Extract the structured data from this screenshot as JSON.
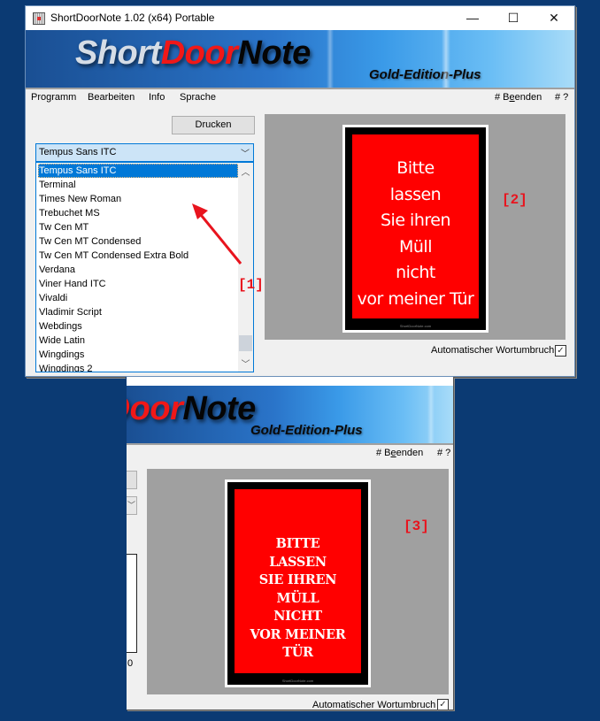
{
  "window": {
    "title": "ShortDoorNote 1.02  (x64) Portable",
    "controls": {
      "minimize": "—",
      "maximize": "☐",
      "close": "✕"
    }
  },
  "banner": {
    "logo_part1": "Short",
    "logo_part2": "Door",
    "logo_part3": "Note",
    "edition": "Gold-Edition-Plus"
  },
  "menu": {
    "items": [
      "Programm",
      "Bearbeiten",
      "Info",
      "Sprache"
    ],
    "right": {
      "quit_prefix": "# B",
      "quit_underlined": "e",
      "quit_suffix": "enden",
      "help": "# ?"
    }
  },
  "toolbar": {
    "print_label": "Drucken"
  },
  "font_select": {
    "selected": "Tempus Sans ITC",
    "options": [
      "Tempus Sans ITC",
      "Terminal",
      "Times New Roman",
      "Trebuchet MS",
      "Tw Cen MT",
      "Tw Cen MT Condensed",
      "Tw Cen MT Condensed Extra Bold",
      "Verdana",
      "Viner Hand ITC",
      "Vivaldi",
      "Vladimir Script",
      "Webdings",
      "Wide Latin",
      "Wingdings",
      "Wingdings 2"
    ]
  },
  "note": {
    "lines": [
      "Bitte",
      "lassen",
      "Sie ihren",
      "Müll",
      "nicht",
      "vor meiner Tür"
    ],
    "lines_upper": [
      "BITTE",
      "LASSEN",
      "SIE IHREN",
      "MÜLL",
      "NICHT",
      "VOR MEINER TÜR"
    ],
    "footer": "ShortDoorNote.com",
    "colors": {
      "background": "#ff0000",
      "border": "#000000",
      "text": "#ffffff"
    }
  },
  "options": {
    "word_wrap_label": "Automatischer Wortumbruch",
    "word_wrap_checked": true,
    "check_glyph": "✓"
  },
  "annotations": {
    "a1": "[1]",
    "a2": "[2]",
    "a3": "[3]"
  },
  "second_window": {
    "partial_value": "0"
  }
}
